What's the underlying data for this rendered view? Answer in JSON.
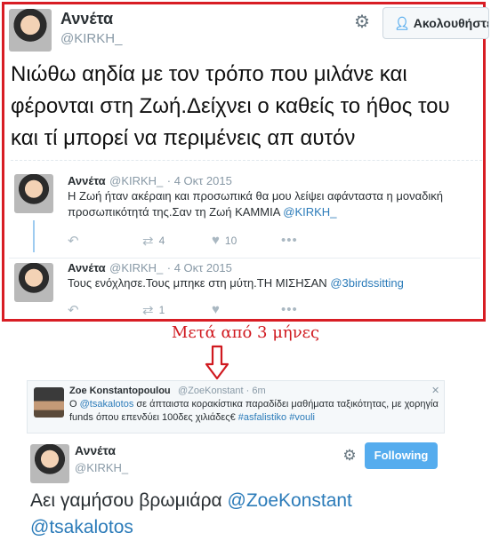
{
  "top_tweet": {
    "name": "Αννέτα",
    "handle": "@KIRKH_",
    "follow_label": "Ακολουθήστε",
    "text": "Νιώθω αηδία με τον τρόπο που μιλάνε και φέρονται στη Ζωή.Δείχνει ο καθείς το ήθος του και τί μπορεί να περιμένεις απ αυτόν"
  },
  "replies": [
    {
      "name": "Αννέτα",
      "handle": "@KIRKH_",
      "date": "· 4 Οκτ 2015",
      "text": "Η Ζωή ήταν ακέραιη και προσωπικά θα μου λείψει αφάνταστα η μοναδική προσωπικότητά της.Σαν τη Ζωή ΚΑΜΜΙΑ ",
      "mention": "@KIRKH_",
      "retweets": "4",
      "likes": "10"
    },
    {
      "name": "Αννέτα",
      "handle": "@KIRKH_",
      "date": "· 4 Οκτ 2015",
      "text": "Τους ενόχλησε.Τους μπηκε στη μύτη.ΤΗ ΜΙΣΗΣΑΝ ",
      "mention": "@3birdssitting",
      "retweets": "1",
      "likes": ""
    }
  ],
  "caption": "Μετά από 3 μήνες",
  "zoe_tweet": {
    "name": "Zoe Konstantopoulou",
    "handle": "@ZoeKonstant",
    "time": "· 6m",
    "mention": "@tsakalotos",
    "text_1": "Ο ",
    "text_2": " σε άπταιστα κορακίστικα παραδίδει μαθήματα ταξικότητας, με χορηγία funds όπου επενδύει 100δες χιλιάδες€ ",
    "hashtag_1": "#asfalistiko",
    "hashtag_2": "#vouli"
  },
  "bottom_tweet": {
    "name": "Αννέτα",
    "handle": "@KIRKH_",
    "follow_label": "Following",
    "text_prefix": "Αει γαμήσου βρωμιάρα ",
    "mention_1": "@ZoeKonstant",
    "mention_2": "@tsakalotos"
  },
  "colors": {
    "frame_red": "#d81d24",
    "link_blue": "#2b7bb9",
    "follow_blue": "#55acee"
  },
  "icons": [
    "gear-icon",
    "add-user-icon",
    "reply-icon",
    "retweet-icon",
    "heart-icon",
    "more-icon",
    "close-icon",
    "down-arrow-icon"
  ]
}
